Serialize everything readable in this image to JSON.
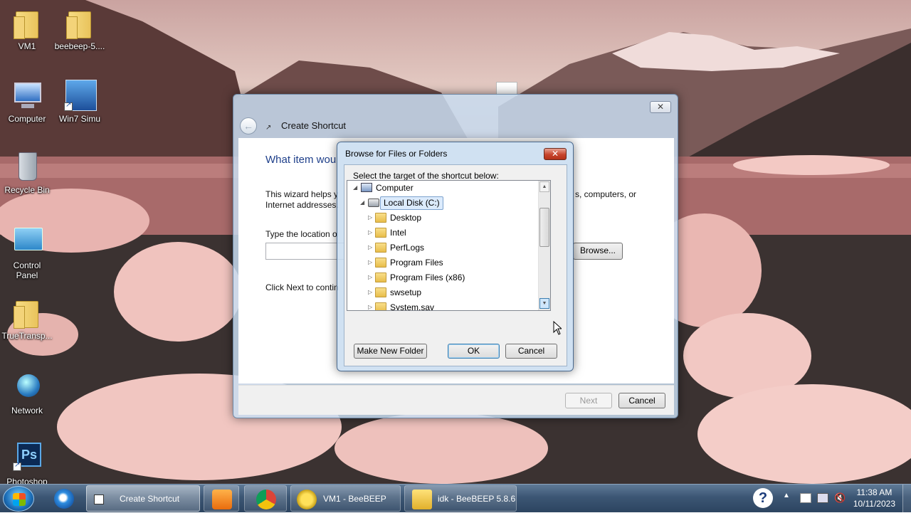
{
  "desktop": {
    "icons": [
      {
        "label": "VM1"
      },
      {
        "label": "beebeep-5...."
      },
      {
        "label": "Computer"
      },
      {
        "label": "Win7 Simu"
      },
      {
        "label": "Recycle Bin"
      },
      {
        "label": "Control Panel"
      },
      {
        "label": "TrueTransp..."
      },
      {
        "label": "Network"
      },
      {
        "label": "Photoshop"
      }
    ]
  },
  "wizard": {
    "title": "Create Shortcut",
    "close_icon": "close-icon",
    "heading": "What item wou",
    "description_left": "This wizard helps y",
    "description_right": "s, computers, or",
    "description_line2": "Internet addresses.",
    "location_label": "Type the location o",
    "browse_label": "Browse...",
    "click_next": "Click Next to contin",
    "next_label": "Next",
    "cancel_label": "Cancel"
  },
  "browse_dialog": {
    "title": "Browse for Files or Folders",
    "prompt": "Select the target of the shortcut below:",
    "tree": [
      {
        "label": "Computer",
        "icon": "computer-icon",
        "expanded": true
      },
      {
        "label": "Local Disk (C:)",
        "icon": "disk-icon",
        "expanded": true,
        "selected": true
      },
      {
        "label": "Desktop",
        "icon": "folder-icon"
      },
      {
        "label": "Intel",
        "icon": "folder-icon"
      },
      {
        "label": "PerfLogs",
        "icon": "folder-icon"
      },
      {
        "label": "Program Files",
        "icon": "folder-icon"
      },
      {
        "label": "Program Files (x86)",
        "icon": "folder-icon"
      },
      {
        "label": "swsetup",
        "icon": "folder-icon"
      },
      {
        "label": "System.sav",
        "icon": "folder-icon"
      }
    ],
    "make_new_folder_label": "Make New Folder",
    "ok_label": "OK",
    "cancel_label": "Cancel"
  },
  "taskbar": {
    "items": [
      {
        "label": "Create Shortcut"
      },
      {
        "label": "VM1 - BeeBEEP"
      },
      {
        "label": "idk - BeeBEEP 5.8.6"
      }
    ],
    "clock_time": "11:38 AM",
    "clock_date": "10/11/2023"
  }
}
